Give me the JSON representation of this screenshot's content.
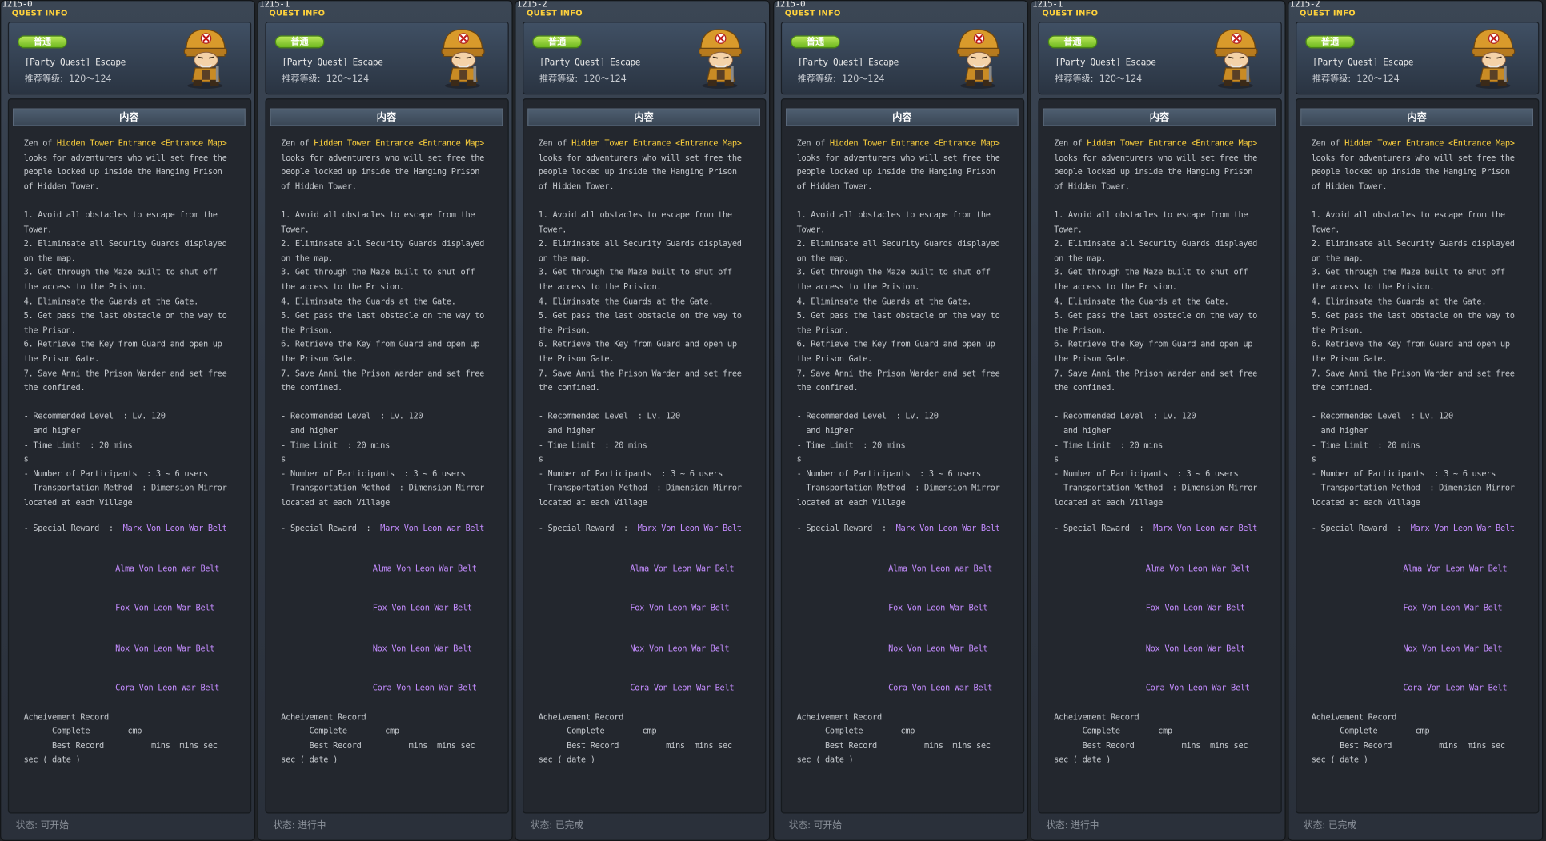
{
  "panels": [
    {
      "id": "1215-0",
      "status": "状态:  可开始"
    },
    {
      "id": "1215-1",
      "status": "状态:  进行中"
    },
    {
      "id": "1215-2",
      "status": "状态:  已完成"
    },
    {
      "id": "1215-0",
      "status": "状态:  可开始"
    },
    {
      "id": "1215-1",
      "status": "状态:  进行中"
    },
    {
      "id": "1215-2",
      "status": "状态:  已完成"
    }
  ],
  "quest": {
    "window_title": "QUEST INFO",
    "badge": "普通",
    "name": "[Party Quest] Escape",
    "level_label": "推荐等级:",
    "level_range": "120～124",
    "content_tab": "内容",
    "intro_prefix": "Zen of ",
    "intro_place": "Hidden Tower Entrance <Entrance Map>",
    "intro_lines": [
      "looks for adventurers who will set free the",
      "people locked up inside the Hanging Prison",
      "of Hidden Tower."
    ],
    "steps": [
      "1. Avoid all obstacles to escape from the",
      "Tower.",
      "2. Eliminsate all Security Guards displayed",
      "on the map.",
      "3. Get through the Maze built to shut off",
      "the access to the Prision.",
      "4. Eliminsate the Guards at the Gate.",
      "5. Get pass the last obstacle on the way to",
      "the Prison.",
      "6. Retrieve the Key from Guard and open up",
      "the Prison Gate.",
      "7. Save Anni the Prison Warder and set free",
      "the confined."
    ],
    "info": [
      "- Recommended Level  : Lv. 120",
      "  and higher",
      "- Time Limit  : 20 mins",
      "s",
      "- Number of Participants  : 3 ~ 6 users",
      "- Transportation Method  : Dimension Mirror",
      "located at each Village"
    ],
    "special_reward_label": "- Special Reward  :",
    "rewards": [
      "Marx Von Leon War Belt",
      "Alma Von Leon War Belt",
      "Fox Von Leon War Belt",
      "Nox Von Leon War Belt",
      "Cora Von Leon War Belt"
    ],
    "record": [
      "Acheivement Record",
      "      Complete        cmp",
      "      Best Record          mins  mins sec",
      "sec ( date )"
    ]
  },
  "colors": {
    "title": "#ffd23c",
    "highlight": "#ffd23c",
    "reward": "#c48cff",
    "badge": "#8fd336",
    "body_text": "#c3c7cc"
  },
  "icons": {
    "npc": "npc-guard-portrait-icon"
  }
}
